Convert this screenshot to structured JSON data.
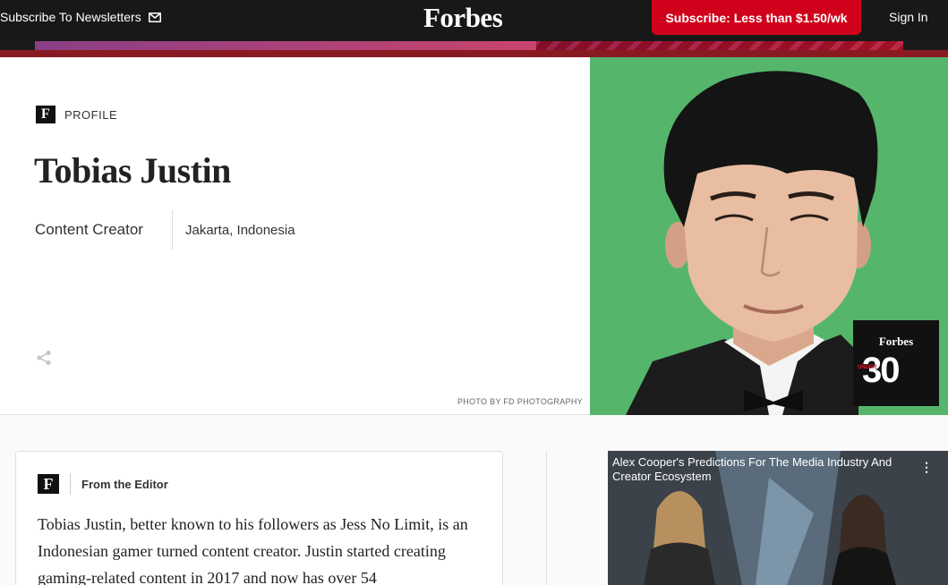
{
  "nav": {
    "newsletter_label": "Subscribe To Newsletters",
    "logo": "Forbes",
    "subscribe_label": "Subscribe: Less than $1.50/wk",
    "signin_label": "Sign In"
  },
  "profile": {
    "tag": "PROFILE",
    "badge_letter": "F",
    "name": "Tobias Justin",
    "title": "Content Creator",
    "location": "Jakarta, Indonesia",
    "photo_credit": "PHOTO BY FD PHOTOGRAPHY"
  },
  "under30": {
    "brand": "Forbes",
    "under": "UNDER",
    "number": "30"
  },
  "editor": {
    "badge_letter": "F",
    "label": "From the Editor",
    "text": "Tobias Justin, better known to his followers as Jess No Limit, is an Indonesian gamer turned content creator. Justin started creating gaming-related content in 2017 and now has over 54"
  },
  "video": {
    "title": "Alex Cooper's Predictions For The Media Industry And Creator Ecosystem",
    "menu": "⋮"
  },
  "colors": {
    "nav_bg": "#181818",
    "subscribe_bg": "#d0021b",
    "portrait_bg": "#55b66b"
  }
}
